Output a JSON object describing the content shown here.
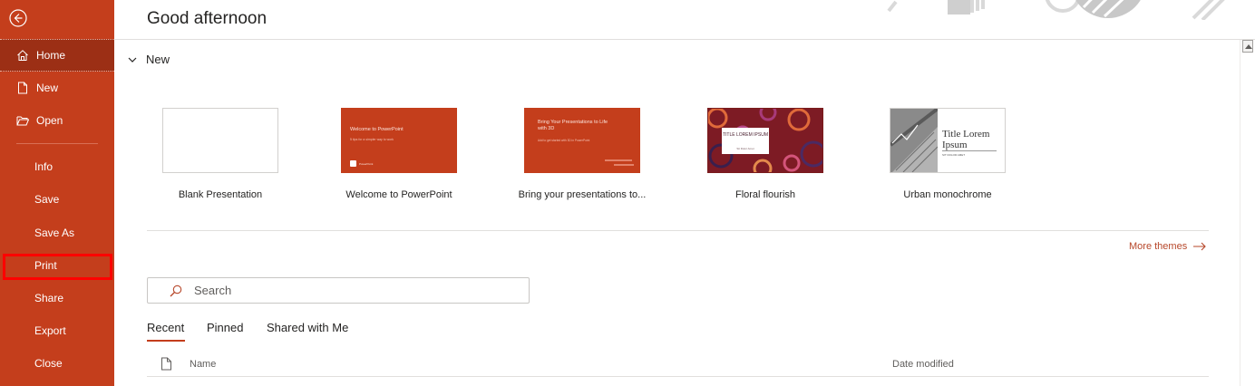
{
  "sidebar": {
    "back_icon": "back-arrow-circle-icon",
    "items": [
      {
        "label": "Home",
        "icon": "home-icon"
      },
      {
        "label": "New",
        "icon": "new-document-icon"
      },
      {
        "label": "Open",
        "icon": "open-folder-icon"
      },
      {
        "label": "Info"
      },
      {
        "label": "Save"
      },
      {
        "label": "Save As"
      },
      {
        "label": "Print"
      },
      {
        "label": "Share"
      },
      {
        "label": "Export"
      },
      {
        "label": "Close"
      }
    ]
  },
  "header": {
    "greeting": "Good afternoon"
  },
  "new_section": {
    "title": "New",
    "templates": [
      {
        "label": "Blank Presentation",
        "thumb_title": "",
        "thumb_sub": ""
      },
      {
        "label": "Welcome to PowerPoint",
        "thumb_title": "Welcome to PowerPoint",
        "thumb_sub": "5 tips for a simpler way to work",
        "thumb_tag": "PowerPoint"
      },
      {
        "label": "Bring your presentations to...",
        "thumb_title": "Bring Your Presentations to Life with 3D",
        "thumb_sub": "Add to get started with 3D in PowerPoint"
      },
      {
        "label": "Floral flourish",
        "thumb_title": "TITLE LOREM IPSUM",
        "thumb_sub": "Sit Dolor Amet"
      },
      {
        "label": "Urban monochrome",
        "thumb_title": "Title Lorem Ipsum",
        "thumb_sub": "SIT DOLOR AMET"
      }
    ],
    "more_themes": "More themes"
  },
  "search": {
    "placeholder": "Search",
    "value": ""
  },
  "tabs": [
    {
      "label": "Recent",
      "active": true
    },
    {
      "label": "Pinned",
      "active": false
    },
    {
      "label": "Shared with Me",
      "active": false
    }
  ],
  "file_list": {
    "col_name": "Name",
    "col_date": "Date modified"
  },
  "colors": {
    "accent": "#c43e1c",
    "sidebar_selected": "#9c2f15",
    "link": "#b7472a",
    "highlight_box": "#ff0000"
  }
}
